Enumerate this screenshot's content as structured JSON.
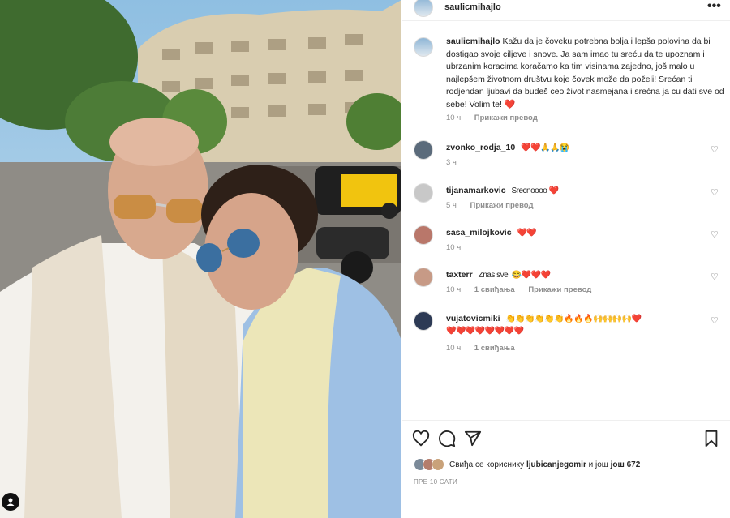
{
  "post": {
    "username": "saulicmihajlo",
    "more_icon": "more-horizontal-icon",
    "caption_username": "saulicmihajlo",
    "caption": "Kažu da je čoveku potrebna bolja i lepša polovina da bi dostigao svoje ciljeve i snove. Ja sam imao tu sreću da te upoznam i ubrzanim koracima koračamo ka tim visinama zajedno, još malo u najlepšem životnom društvu koje čovek može da poželi! Srećan ti rodjendan ljubavi da budeš ceo život nasmejana i srećna ja cu dati sve od sebe! Volim te!",
    "caption_heart": "❤️",
    "caption_time": "10 ч",
    "caption_translate": "Прикажи превод"
  },
  "comments": [
    {
      "user": "zvonko_rodja_10",
      "text": "❤️❤️🙏🙏😭",
      "time": "3 ч",
      "likes": "",
      "translate": ""
    },
    {
      "user": "tijanamarkovic",
      "text": "Srecnoooo ❤️",
      "time": "5 ч",
      "likes": "",
      "translate": "Прикажи превод"
    },
    {
      "user": "sasa_milojkovic",
      "text": "❤️❤️",
      "time": "10 ч",
      "likes": "",
      "translate": ""
    },
    {
      "user": "taxterr",
      "text": "Znas sve. 😂❤️❤️❤️",
      "time": "10 ч",
      "likes": "1 свиђања",
      "translate": "Прикажи превод"
    },
    {
      "user": "vujatovicmiki",
      "text": "👏👏👏👏👏👏🔥🔥🔥🙌🙌🙌🙌❤️",
      "text2": "❤️❤️❤️❤️❤️❤️❤️❤️",
      "time": "10 ч",
      "likes": "1 свиђања",
      "translate": ""
    }
  ],
  "actions": {
    "like_icon": "heart-icon",
    "comment_icon": "comment-icon",
    "share_icon": "share-icon",
    "save_icon": "bookmark-icon"
  },
  "likes": {
    "prefix": "Свиђа се кориснику",
    "user": "ljubicanjegomir",
    "middle": "и још",
    "count": "још 672"
  },
  "posted_ago": "ПРЕ 10 САТИ",
  "colors": {
    "text": "#262626",
    "muted": "#8e8e8e",
    "heart": "#ed2b40",
    "border": "#efefef"
  }
}
